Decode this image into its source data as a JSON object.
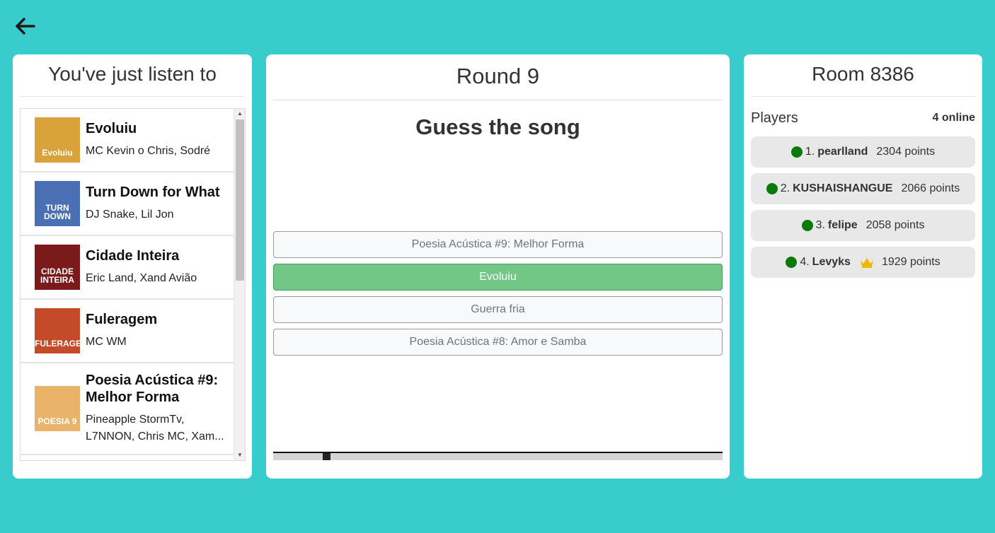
{
  "history": {
    "title": "You've just listen to",
    "songs": [
      {
        "title": "Evoluiu",
        "artist": "MC Kevin o Chris, Sodré",
        "art_text": "Evoluiu",
        "art_bg": "#d9a23b"
      },
      {
        "title": "Turn Down for What",
        "artist": "DJ Snake, Lil Jon",
        "art_text": "TURN DOWN",
        "art_bg": "#4a6fb5"
      },
      {
        "title": "Cidade Inteira",
        "artist": "Eric Land, Xand Avião",
        "art_text": "CIDADE INTEIRA",
        "art_bg": "#7a1a1a"
      },
      {
        "title": "Fuleragem",
        "artist": "MC WM",
        "art_text": "FULERAGEM",
        "art_bg": "#c44b2a"
      },
      {
        "title": "Poesia Acústica #9: Melhor Forma",
        "artist": "Pineapple StormTv, L7NNON, Chris MC, Xam...",
        "art_text": "POESIA 9",
        "art_bg": "#e9b36a"
      }
    ]
  },
  "round": {
    "title": "Round 9",
    "prompt": "Guess the song",
    "choices": [
      {
        "label": "Poesia Acústica #9: Melhor Forma",
        "correct": false
      },
      {
        "label": "Evoluiu",
        "correct": true
      },
      {
        "label": "Guerra fria",
        "correct": false
      },
      {
        "label": "Poesia Acústica #8: Amor e Samba",
        "correct": false
      }
    ],
    "progress": 0.11
  },
  "room": {
    "title": "Room 8386",
    "players_label": "Players",
    "online": "4 online",
    "players": [
      {
        "rank": "1.",
        "name": "pearlland",
        "points": "2304 points",
        "crown": false
      },
      {
        "rank": "2.",
        "name": "KUSHAISHANGUE",
        "points": "2066 points",
        "crown": false
      },
      {
        "rank": "3.",
        "name": "felipe",
        "points": "2058 points",
        "crown": false
      },
      {
        "rank": "4.",
        "name": "Levyks",
        "points": "1929 points",
        "crown": true
      }
    ]
  },
  "colors": {
    "background": "#38cccc",
    "correct": "#72c686",
    "online_dot": "#0a7a0a",
    "crown": "#f2b705"
  },
  "icons": {
    "back": "arrow-left-icon",
    "online": "online-dot-icon",
    "crown": "crown-icon"
  }
}
